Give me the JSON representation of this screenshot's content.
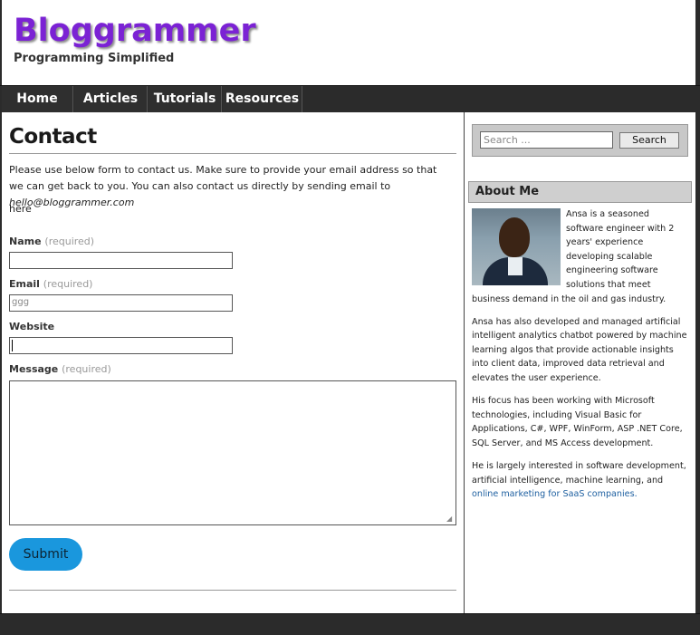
{
  "site": {
    "title": "Bloggrammer",
    "tagline": "Programming Simplified"
  },
  "nav": {
    "items": [
      "Home",
      "Articles",
      "Tutorials",
      "Resources"
    ]
  },
  "page": {
    "title": "Contact",
    "intro": "Please use below  form to contact us. Make sure to provide your email address so that we can get back to you. You can also contact us directly by sending email to ",
    "intro_email": "hello@bloggrammer.com",
    "intro_here": "here"
  },
  "form": {
    "name_label": "Name",
    "name_req": "(required)",
    "name_value": "",
    "email_label": "Email",
    "email_req": "(required)",
    "email_value": "ggg",
    "website_label": "Website",
    "website_value": "",
    "message_label": "Message",
    "message_req": "(required)",
    "submit_label": "Submit"
  },
  "sidebar": {
    "search_placeholder": "Search ...",
    "search_button": "Search",
    "about_title": "About Me",
    "about_p1": "Ansa is a seasoned software engineer with 2 years' experience developing scalable engineering software solutions that meet business demand in the oil and gas industry.",
    "about_p2": "Ansa has also developed and managed artificial intelligent analytics chatbot powered by machine learning algos that provide actionable insights into client data, improved data retrieval and elevates the user experience.",
    "about_p3": "His focus has been working with Microsoft technologies, including Visual Basic for Applications, C#, WPF, WinForm, ASP .NET Core, SQL Server, and MS Access development.",
    "about_p4": "He is largely interested in software development, artificial intelligence, machine learning, and",
    "about_link": "online marketing for SaaS companies."
  },
  "colors": {
    "title": "#7b22d4",
    "nav_bg": "#2b2b2b",
    "submit_bg": "#1a97dd",
    "link": "#1d5fa0"
  }
}
